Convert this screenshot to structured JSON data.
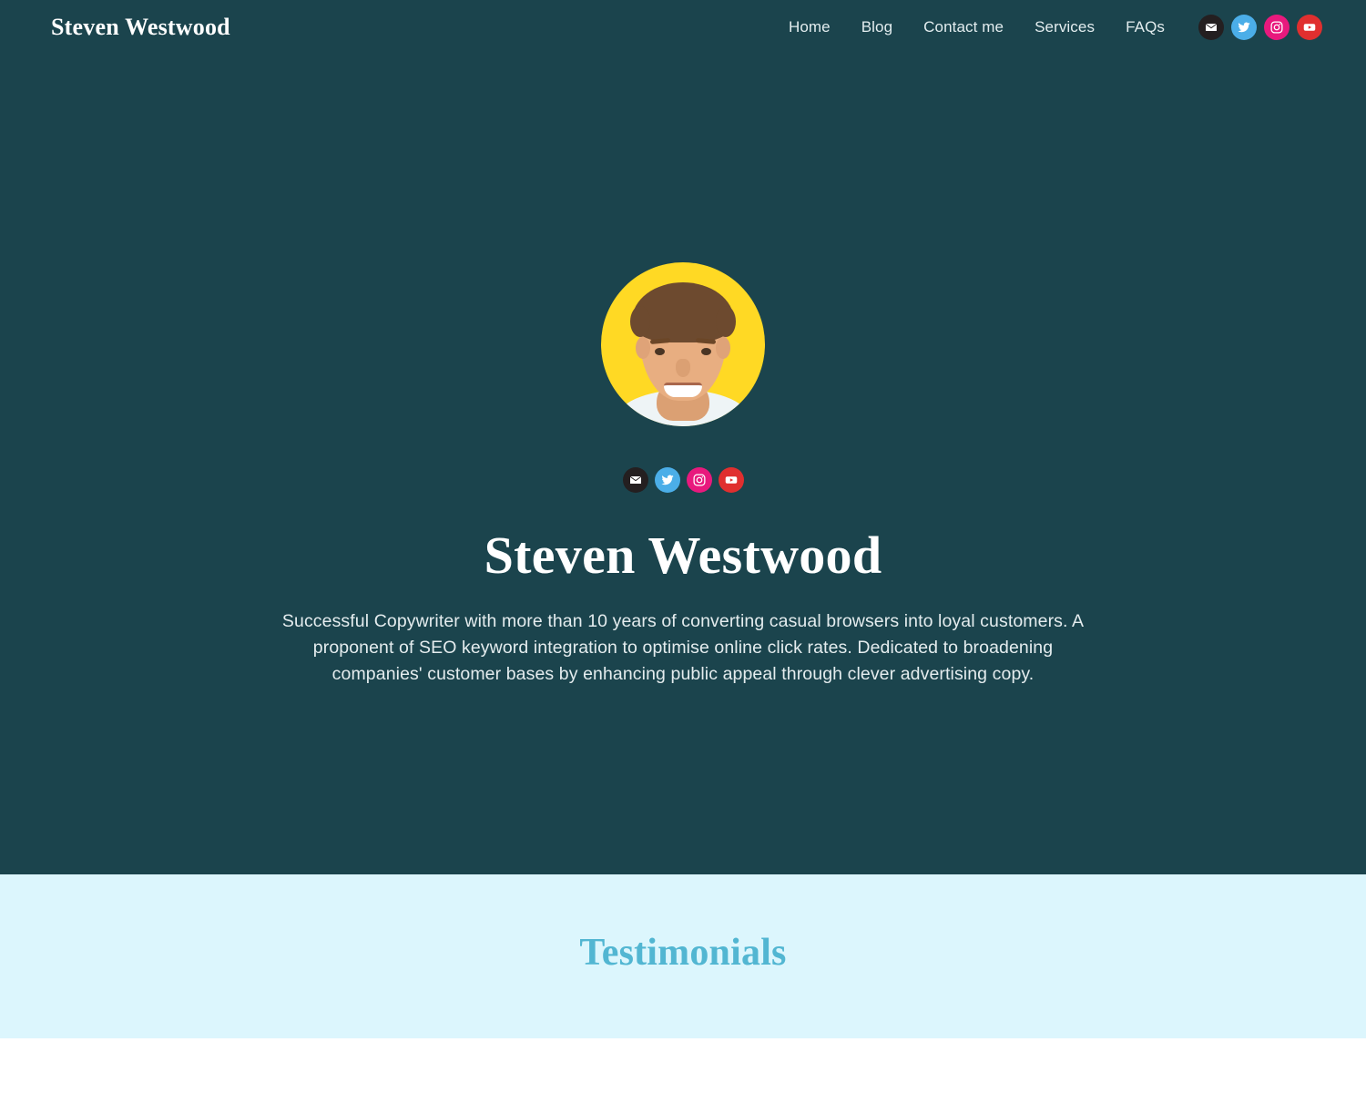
{
  "header": {
    "brand": "Steven Westwood",
    "nav": [
      {
        "label": "Home",
        "name": "nav-link-home"
      },
      {
        "label": "Blog",
        "name": "nav-link-blog"
      },
      {
        "label": "Contact me",
        "name": "nav-link-contact-me"
      },
      {
        "label": "Services",
        "name": "nav-link-services"
      },
      {
        "label": "FAQs",
        "name": "nav-link-faqs"
      }
    ],
    "social": [
      {
        "icon": "email-icon",
        "label": "Email",
        "color": "#241f20"
      },
      {
        "icon": "twitter-icon",
        "label": "Twitter",
        "color": "#4baee8"
      },
      {
        "icon": "instagram-icon",
        "label": "Instagram",
        "color": "#e8197d"
      },
      {
        "icon": "youtube-icon",
        "label": "YouTube",
        "color": "#e02f2f"
      }
    ]
  },
  "hero": {
    "avatar_alt": "Steven Westwood portrait",
    "avatar_background": "#ffd924",
    "title": "Steven Westwood",
    "bio": "Successful Copywriter with more than 10 years of converting casual browsers into loyal customers. A proponent of SEO keyword integration to optimise online click rates. Dedicated to broadening companies' customer bases by enhancing public appeal through clever advertising copy.",
    "background": "#1b444d",
    "social": [
      {
        "icon": "email-icon",
        "label": "Email",
        "color": "#241f20"
      },
      {
        "icon": "twitter-icon",
        "label": "Twitter",
        "color": "#4baee8"
      },
      {
        "icon": "instagram-icon",
        "label": "Instagram",
        "color": "#e8197d"
      },
      {
        "icon": "youtube-icon",
        "label": "YouTube",
        "color": "#e02f2f"
      }
    ]
  },
  "testimonials": {
    "title": "Testimonials",
    "background": "#dcf6fd",
    "title_color": "#52b6d2"
  }
}
